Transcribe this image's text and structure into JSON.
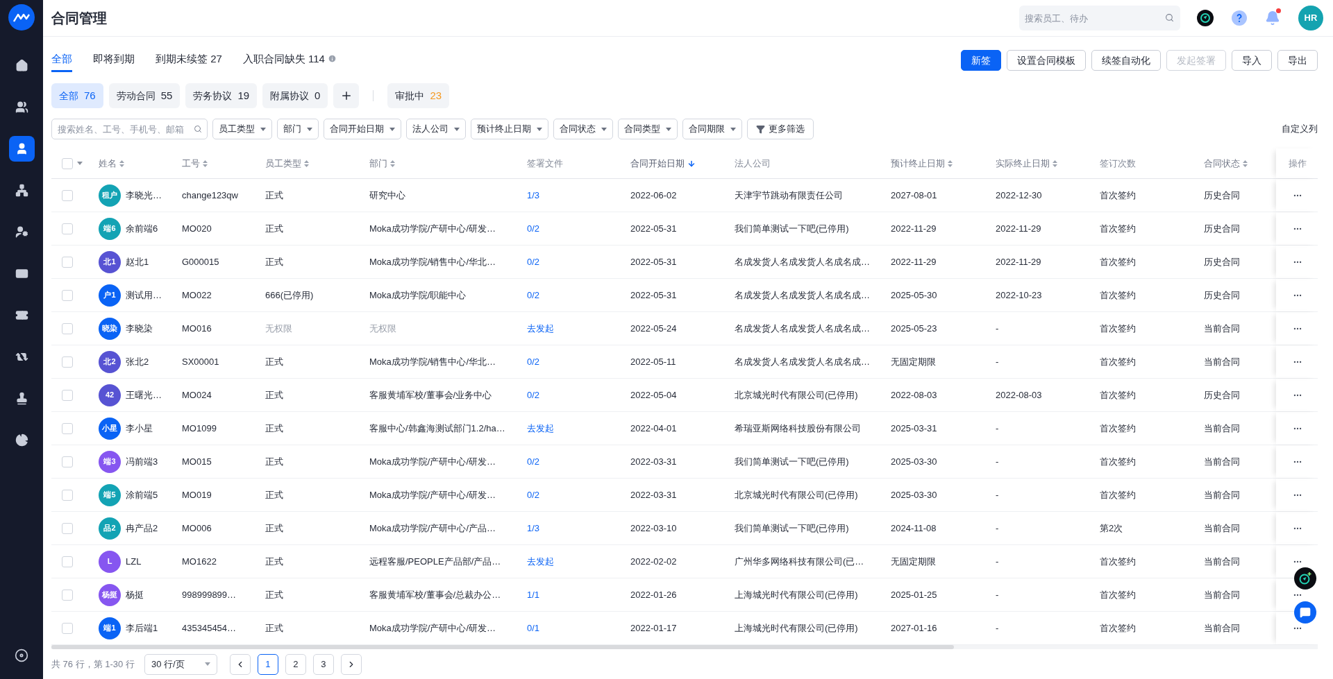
{
  "sidebar": {
    "items": [
      {
        "selected": false
      },
      {
        "selected": false
      },
      {
        "selected": true
      },
      {
        "selected": false
      },
      {
        "selected": false
      },
      {
        "selected": false
      },
      {
        "selected": false
      },
      {
        "selected": false
      },
      {
        "selected": false
      },
      {
        "selected": false
      }
    ]
  },
  "header": {
    "title": "合同管理",
    "search": {
      "placeholder": "搜索员工、待办"
    },
    "avatar": "HR",
    "has_notification": true
  },
  "tabs": [
    {
      "label": "全部",
      "selected": true,
      "info": false
    },
    {
      "label": "即将到期",
      "selected": false,
      "info": false
    },
    {
      "label": "到期未续签 27",
      "selected": false,
      "info": false
    },
    {
      "label": "入职合同缺失 114",
      "selected": false,
      "info": true
    }
  ],
  "actions": [
    {
      "label": "新签",
      "kind": "primary",
      "disabled": false
    },
    {
      "label": "设置合同模板",
      "kind": "default",
      "disabled": false
    },
    {
      "label": "续签自动化",
      "kind": "default",
      "disabled": false
    },
    {
      "label": "发起签署",
      "kind": "default",
      "disabled": true
    },
    {
      "label": "导入",
      "kind": "default",
      "disabled": false
    },
    {
      "label": "导出",
      "kind": "default",
      "disabled": false
    }
  ],
  "chips": [
    {
      "label": "全部",
      "count": "76",
      "selected": true
    },
    {
      "label": "劳动合同",
      "count": "55",
      "selected": false
    },
    {
      "label": "劳务协议",
      "count": "19",
      "selected": false
    },
    {
      "label": "附属协议",
      "count": "0",
      "selected": false
    }
  ],
  "approval_chip": {
    "label": "审批中",
    "count": "23"
  },
  "filters": {
    "search": {
      "placeholder": "搜索姓名、工号、手机号、邮箱"
    },
    "dropdowns": [
      "员工类型",
      "部门",
      "合同开始日期",
      "法人公司",
      "预计终止日期",
      "合同状态",
      "合同类型",
      "合同期限"
    ],
    "more": "更多筛选",
    "customize": "自定义列"
  },
  "table": {
    "select_all": {
      "checked": false
    },
    "columns": [
      {
        "label": "姓名",
        "sortable": true,
        "sorted": false
      },
      {
        "label": "工号",
        "sortable": true,
        "sorted": false
      },
      {
        "label": "员工类型",
        "sortable": true,
        "sorted": false
      },
      {
        "label": "部门",
        "sortable": true,
        "sorted": false
      },
      {
        "label": "签署文件",
        "sortable": false,
        "sorted": false
      },
      {
        "label": "合同开始日期",
        "sortable": true,
        "sorted": true
      },
      {
        "label": "法人公司",
        "sortable": false,
        "sorted": false
      },
      {
        "label": "预计终止日期",
        "sortable": true,
        "sorted": false
      },
      {
        "label": "实际终止日期",
        "sortable": true,
        "sorted": false
      },
      {
        "label": "签订次数",
        "sortable": false,
        "sorted": false
      },
      {
        "label": "合同状态",
        "sortable": true,
        "sorted": false
      },
      {
        "label": "操作",
        "sortable": false,
        "sorted": false
      }
    ],
    "rows": [
      {
        "checked": false,
        "avatar": "租户",
        "color": "#13a3b4",
        "name": "李晓光…",
        "employee_id": "change123qw",
        "employee_type": "正式",
        "department": "研究中心",
        "no_access": false,
        "sign_file": "1/3",
        "start_date": "2022-06-02",
        "company": "天津宇节跳动有限责任公司",
        "expected_end": "2027-08-01",
        "actual_end": "2022-12-30",
        "sign_count": "首次签约",
        "status": "历史合同"
      },
      {
        "checked": false,
        "avatar": "端6",
        "color": "#13a3b4",
        "name": "余前端6",
        "employee_id": "MO020",
        "employee_type": "正式",
        "department": "Moka成功学院/产研中心/研发…",
        "no_access": false,
        "sign_file": "0/2",
        "start_date": "2022-05-31",
        "company": "我们简单测试一下吧(已停用)",
        "expected_end": "2022-11-29",
        "actual_end": "2022-11-29",
        "sign_count": "首次签约",
        "status": "历史合同"
      },
      {
        "checked": false,
        "avatar": "北1",
        "color": "#5753d3",
        "name": "赵北1",
        "employee_id": "G000015",
        "employee_type": "正式",
        "department": "Moka成功学院/销售中心/华北…",
        "no_access": false,
        "sign_file": "0/2",
        "start_date": "2022-05-31",
        "company": "名成发货人名成发货人名成名成…",
        "expected_end": "2022-11-29",
        "actual_end": "2022-11-29",
        "sign_count": "首次签约",
        "status": "历史合同"
      },
      {
        "checked": false,
        "avatar": "户1",
        "color": "#0a63f5",
        "name": "测试用…",
        "employee_id": "MO022",
        "employee_type": "666(已停用)",
        "department": "Moka成功学院/职能中心",
        "no_access": false,
        "sign_file": "0/2",
        "start_date": "2022-05-31",
        "company": "名成发货人名成发货人名成名成…",
        "expected_end": "2025-05-30",
        "actual_end": "2022-10-23",
        "sign_count": "首次签约",
        "status": "历史合同"
      },
      {
        "checked": false,
        "avatar": "晓染",
        "color": "#0a63f5",
        "name": "李晓染",
        "employee_id": "MO016",
        "employee_type": "无权限",
        "department": "无权限",
        "no_access": true,
        "sign_file": "去发起",
        "start_date": "2022-05-24",
        "company": "名成发货人名成发货人名成名成…",
        "expected_end": "2025-05-23",
        "actual_end": "-",
        "sign_count": "首次签约",
        "status": "当前合同"
      },
      {
        "checked": false,
        "avatar": "北2",
        "color": "#5753d3",
        "name": "张北2",
        "employee_id": "SX00001",
        "employee_type": "正式",
        "department": "Moka成功学院/销售中心/华北…",
        "no_access": false,
        "sign_file": "0/2",
        "start_date": "2022-05-11",
        "company": "名成发货人名成发货人名成名成…",
        "expected_end": "无固定期限",
        "actual_end": "-",
        "sign_count": "首次签约",
        "status": "当前合同"
      },
      {
        "checked": false,
        "avatar": "42",
        "color": "#5753d3",
        "name": "王曙光…",
        "employee_id": "MO024",
        "employee_type": "正式",
        "department": "客服黄埔军校/董事会/业务中心",
        "no_access": false,
        "sign_file": "0/2",
        "start_date": "2022-05-04",
        "company": "北京城光时代有限公司(已停用)",
        "expected_end": "2022-08-03",
        "actual_end": "2022-08-03",
        "sign_count": "首次签约",
        "status": "历史合同"
      },
      {
        "checked": false,
        "avatar": "小星",
        "color": "#0a63f5",
        "name": "李小星",
        "employee_id": "MO1099",
        "employee_type": "正式",
        "department": "客服中心/韩鑫海测试部门1.2/ha…",
        "no_access": false,
        "sign_file": "去发起",
        "start_date": "2022-04-01",
        "company": "希瑞亚斯网络科技股份有限公司",
        "expected_end": "2025-03-31",
        "actual_end": "-",
        "sign_count": "首次签约",
        "status": "当前合同"
      },
      {
        "checked": false,
        "avatar": "端3",
        "color": "#8656f0",
        "name": "冯前端3",
        "employee_id": "MO015",
        "employee_type": "正式",
        "department": "Moka成功学院/产研中心/研发…",
        "no_access": false,
        "sign_file": "0/2",
        "start_date": "2022-03-31",
        "company": "我们简单测试一下吧(已停用)",
        "expected_end": "2025-03-30",
        "actual_end": "-",
        "sign_count": "首次签约",
        "status": "当前合同"
      },
      {
        "checked": false,
        "avatar": "端5",
        "color": "#13a3b4",
        "name": "涂前端5",
        "employee_id": "MO019",
        "employee_type": "正式",
        "department": "Moka成功学院/产研中心/研发…",
        "no_access": false,
        "sign_file": "0/2",
        "start_date": "2022-03-31",
        "company": "北京城光时代有限公司(已停用)",
        "expected_end": "2025-03-30",
        "actual_end": "-",
        "sign_count": "首次签约",
        "status": "当前合同"
      },
      {
        "checked": false,
        "avatar": "品2",
        "color": "#13a3b4",
        "name": "冉产品2",
        "employee_id": "MO006",
        "employee_type": "正式",
        "department": "Moka成功学院/产研中心/产品…",
        "no_access": false,
        "sign_file": "1/3",
        "start_date": "2022-03-10",
        "company": "我们简单测试一下吧(已停用)",
        "expected_end": "2024-11-08",
        "actual_end": "-",
        "sign_count": "第2次",
        "status": "当前合同"
      },
      {
        "checked": false,
        "avatar": "L",
        "color": "#8656f0",
        "name": "LZL",
        "employee_id": "MO1622",
        "employee_type": "正式",
        "department": "远程客服/PEOPLE产品部/产品…",
        "no_access": false,
        "sign_file": "去发起",
        "start_date": "2022-02-02",
        "company": "广州华多网络科技有限公司(已…",
        "expected_end": "无固定期限",
        "actual_end": "-",
        "sign_count": "首次签约",
        "status": "当前合同"
      },
      {
        "checked": false,
        "avatar": "杨挺",
        "color": "#8656f0",
        "name": "杨挺",
        "employee_id": "998999899…",
        "employee_type": "正式",
        "department": "客服黄埔军校/董事会/总裁办公…",
        "no_access": false,
        "sign_file": "1/1",
        "start_date": "2022-01-26",
        "company": "上海城光时代有限公司(已停用)",
        "expected_end": "2025-01-25",
        "actual_end": "-",
        "sign_count": "首次签约",
        "status": "当前合同"
      },
      {
        "checked": false,
        "avatar": "端1",
        "color": "#0a63f5",
        "name": "李后端1",
        "employee_id": "435345454…",
        "employee_type": "正式",
        "department": "Moka成功学院/产研中心/研发…",
        "no_access": false,
        "sign_file": "0/1",
        "start_date": "2022-01-17",
        "company": "上海城光时代有限公司(已停用)",
        "expected_end": "2027-01-16",
        "actual_end": "-",
        "sign_count": "首次签约",
        "status": "当前合同"
      }
    ]
  },
  "pagination": {
    "summary": "共 76 行，第 1-30 行",
    "page_size": "30 行/页",
    "pages": [
      {
        "label": "1",
        "selected": true
      },
      {
        "label": "2",
        "selected": false
      },
      {
        "label": "3",
        "selected": false
      }
    ]
  }
}
